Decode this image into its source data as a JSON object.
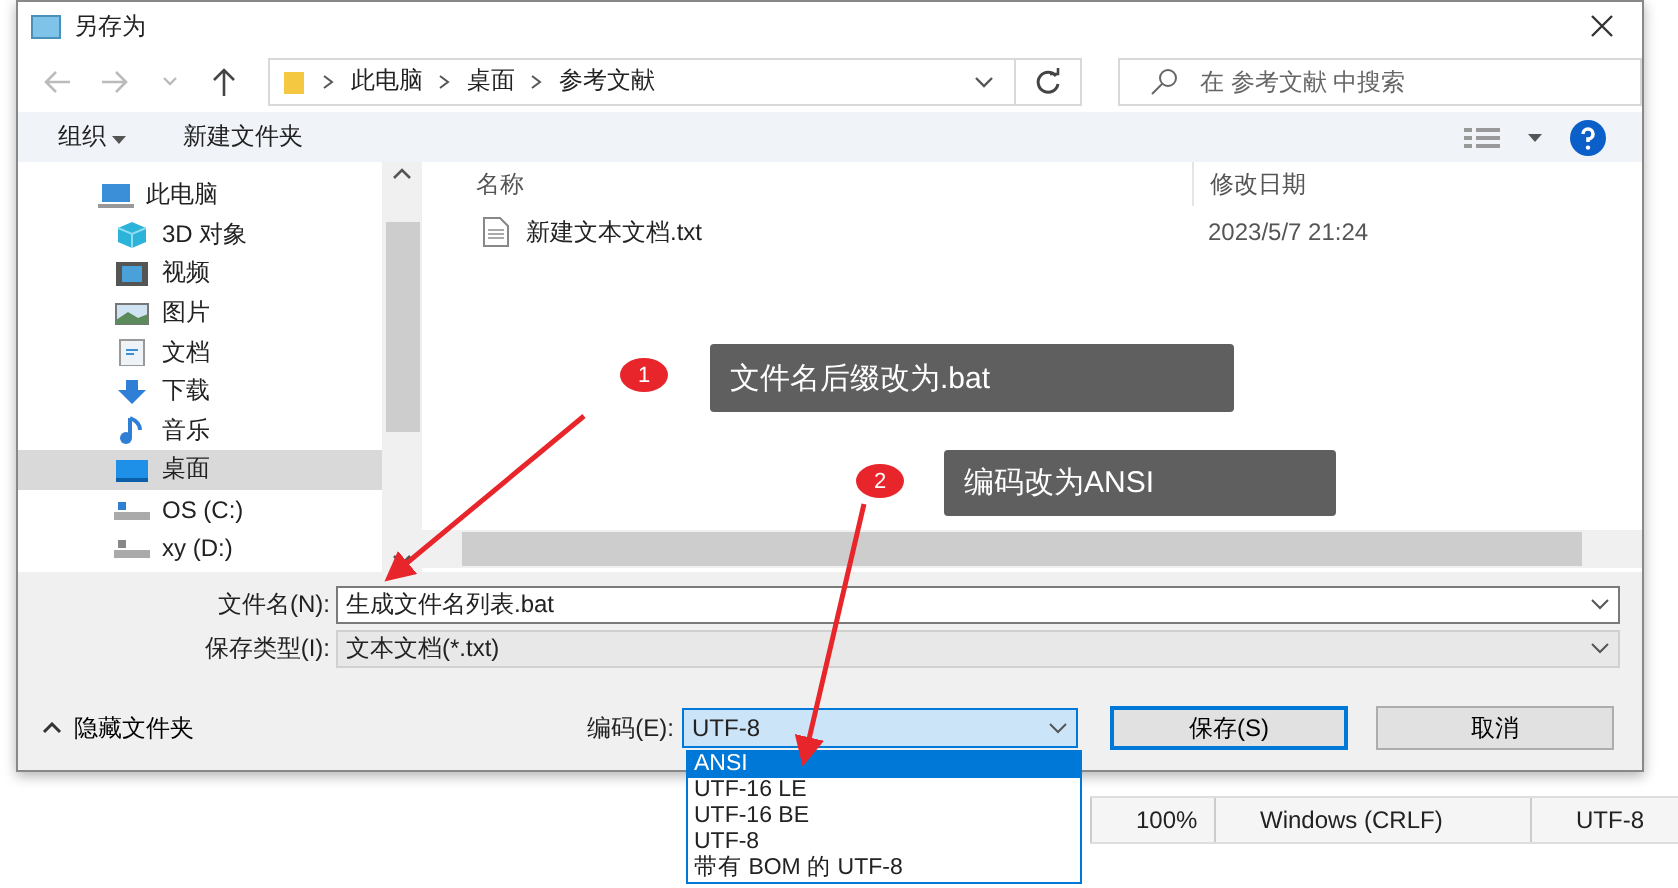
{
  "window": {
    "title": "另存为"
  },
  "nav": {
    "breadcrumbs": [
      "此电脑",
      "桌面",
      "参考文献"
    ],
    "search": {
      "placeholder": "在 参考文献 中搜索"
    }
  },
  "toolbar": {
    "organize": "组织",
    "new_folder": "新建文件夹"
  },
  "sidebar": {
    "items": [
      {
        "label": "此电脑",
        "selected": false,
        "children": [
          {
            "label": "3D 对象",
            "selected": false
          },
          {
            "label": "视频",
            "selected": false
          },
          {
            "label": "图片",
            "selected": false
          },
          {
            "label": "文档",
            "selected": false
          },
          {
            "label": "下载",
            "selected": false
          },
          {
            "label": "音乐",
            "selected": false
          },
          {
            "label": "桌面",
            "selected": true
          },
          {
            "label": "OS (C:)",
            "selected": false
          },
          {
            "label": "xy (D:)",
            "selected": false
          }
        ]
      }
    ]
  },
  "file_list": {
    "columns": [
      "名称",
      "修改日期"
    ],
    "rows": [
      {
        "name": "新建文本文档.txt",
        "modified": "2023/5/7 21:24"
      }
    ]
  },
  "form": {
    "file_name_label": "文件名(N):",
    "file_name": "生成文件名列表.bat",
    "save_type_label": "保存类型(I):",
    "save_type": "文本文档(*.txt)",
    "hide_folders": "隐藏文件夹",
    "encoding_label": "编码(E):",
    "encoding": "UTF-8",
    "expanded": true,
    "encoding_options": [
      {
        "label": "ANSI",
        "selected": true
      },
      {
        "label": "UTF-16 LE",
        "selected": false
      },
      {
        "label": "UTF-16 BE",
        "selected": false
      },
      {
        "label": "UTF-8",
        "selected": false
      },
      {
        "label": "带有 BOM 的 UTF-8",
        "selected": false
      }
    ],
    "buttons": [
      "保存(S)",
      "取消"
    ]
  },
  "annotations": [
    {
      "number": "1",
      "text": "文件名后缀改为.bat"
    },
    {
      "number": "2",
      "text": "编码改为ANSI"
    }
  ],
  "status_bar": {
    "cells": [
      "100%",
      "Windows (CRLF)",
      "UTF-8"
    ]
  }
}
